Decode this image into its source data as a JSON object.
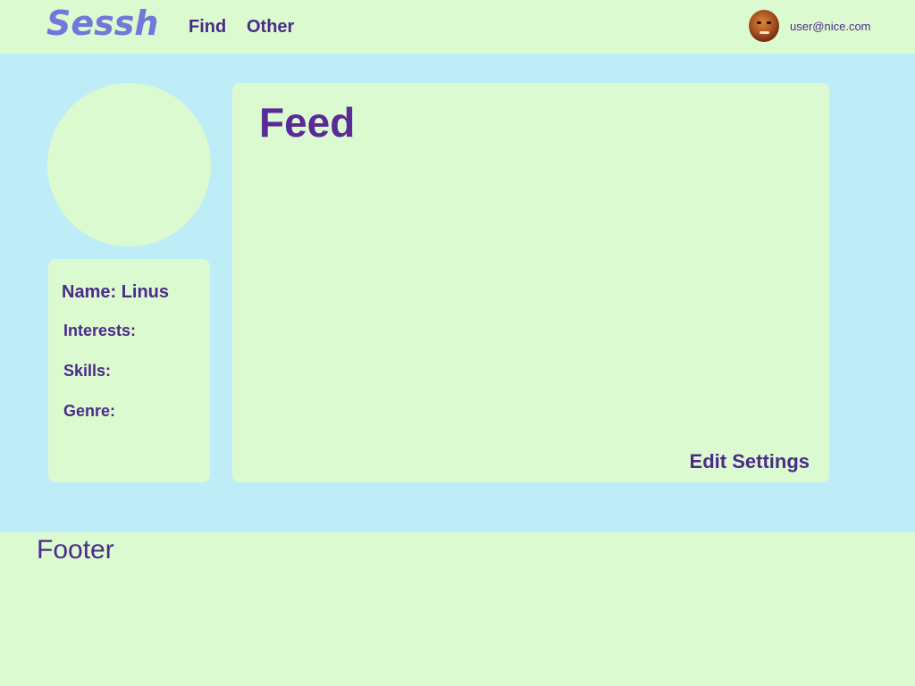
{
  "header": {
    "logo": "Sessh",
    "nav": [
      {
        "label": "Find"
      },
      {
        "label": "Other"
      }
    ],
    "user": {
      "email": "user@nice.com",
      "avatar_icon": "user-avatar"
    }
  },
  "profile": {
    "name_label": "Name: Linus",
    "fields": {
      "interests": "Interests:",
      "skills": "Skills:",
      "genre": "Genre:"
    }
  },
  "feed": {
    "title": "Feed",
    "edit_settings": "Edit Settings"
  },
  "footer": {
    "text": "Footer"
  },
  "colors": {
    "header_bg": "#dcfad0",
    "main_bg": "#bfedf7",
    "panel_bg": "#dcfad0",
    "text": "#4b2a8a",
    "logo": "#7277d9"
  }
}
